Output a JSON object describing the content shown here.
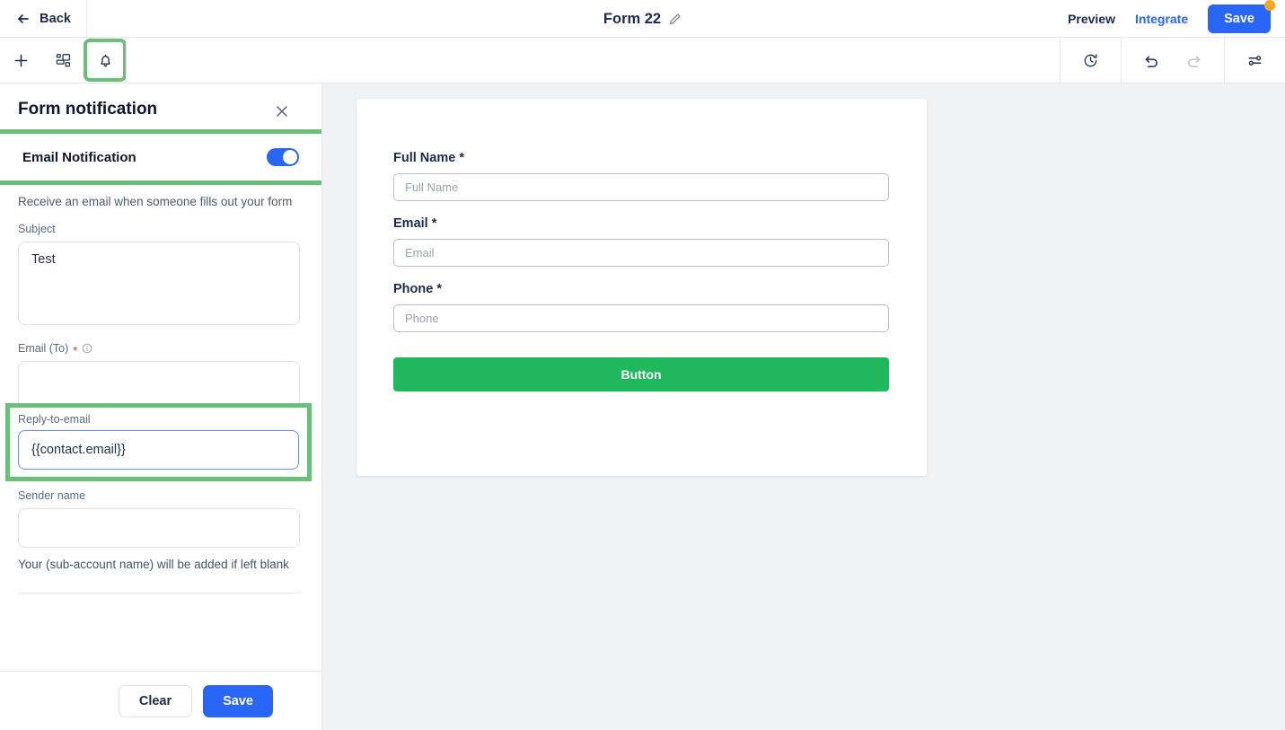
{
  "topbar": {
    "back_label": "Back",
    "back_icon": "arrow-left-icon",
    "form_title": "Form 22",
    "edit_icon": "pencil-icon",
    "preview_label": "Preview",
    "integrate_label": "Integrate",
    "save_label": "Save",
    "save_badge_color": "#f5a623",
    "accent_blue": "#2a66f6"
  },
  "toolbar": {
    "left_items": [
      {
        "name": "add-element-button",
        "icon": "plus-icon",
        "highlighted": false
      },
      {
        "name": "workflow-button",
        "icon": "nodes-icon",
        "highlighted": false
      },
      {
        "name": "notification-button",
        "icon": "bell-icon",
        "highlighted": true
      }
    ],
    "right_items": [
      {
        "name": "version-history-button",
        "icon": "clock-history-icon",
        "disabled": false
      },
      {
        "name": "undo-button",
        "icon": "undo-arrow-icon",
        "disabled": false
      },
      {
        "name": "redo-button",
        "icon": "redo-arrow-icon",
        "disabled": true
      },
      {
        "name": "settings-button",
        "icon": "sliders-icon",
        "disabled": false
      }
    ],
    "highlight_color": "#6cbe7b"
  },
  "panel": {
    "title": "Form notification",
    "close_icon": "close-icon",
    "toggle": {
      "label": "Email Notification",
      "enabled": true,
      "highlighted": true
    },
    "helper_text": "Receive an email when someone fills out your form",
    "fields": [
      {
        "name": "subject",
        "label": "Subject",
        "value": "Test",
        "placeholder": "",
        "required": false,
        "info": false,
        "type": "textarea",
        "focused": false,
        "highlighted": false
      },
      {
        "name": "email-to",
        "label": "Email (To)",
        "value": "",
        "placeholder": "",
        "required": true,
        "info": true,
        "type": "input",
        "focused": false,
        "highlighted": false
      },
      {
        "name": "reply-to-email",
        "label": "Reply-to-email",
        "value": "{{contact.email}}",
        "placeholder": "",
        "required": false,
        "info": false,
        "type": "input",
        "focused": true,
        "highlighted": true
      },
      {
        "name": "sender-name",
        "label": "Sender name",
        "value": "",
        "placeholder": "",
        "required": false,
        "info": false,
        "type": "input",
        "focused": false,
        "highlighted": false
      }
    ],
    "sender_note": "Your (sub-account name) will be added if left blank",
    "footer": {
      "clear_label": "Clear",
      "save_label": "Save"
    }
  },
  "canvas": {
    "background": "#f1f2f4",
    "form_preview": {
      "fields": [
        {
          "name": "full-name",
          "label": "Full Name",
          "required": true,
          "placeholder": "Full Name"
        },
        {
          "name": "email",
          "label": "Email",
          "required": true,
          "placeholder": "Email"
        },
        {
          "name": "phone",
          "label": "Phone",
          "required": true,
          "placeholder": "Phone"
        }
      ],
      "submit_label": "Button",
      "submit_color": "#1fb85c"
    }
  }
}
